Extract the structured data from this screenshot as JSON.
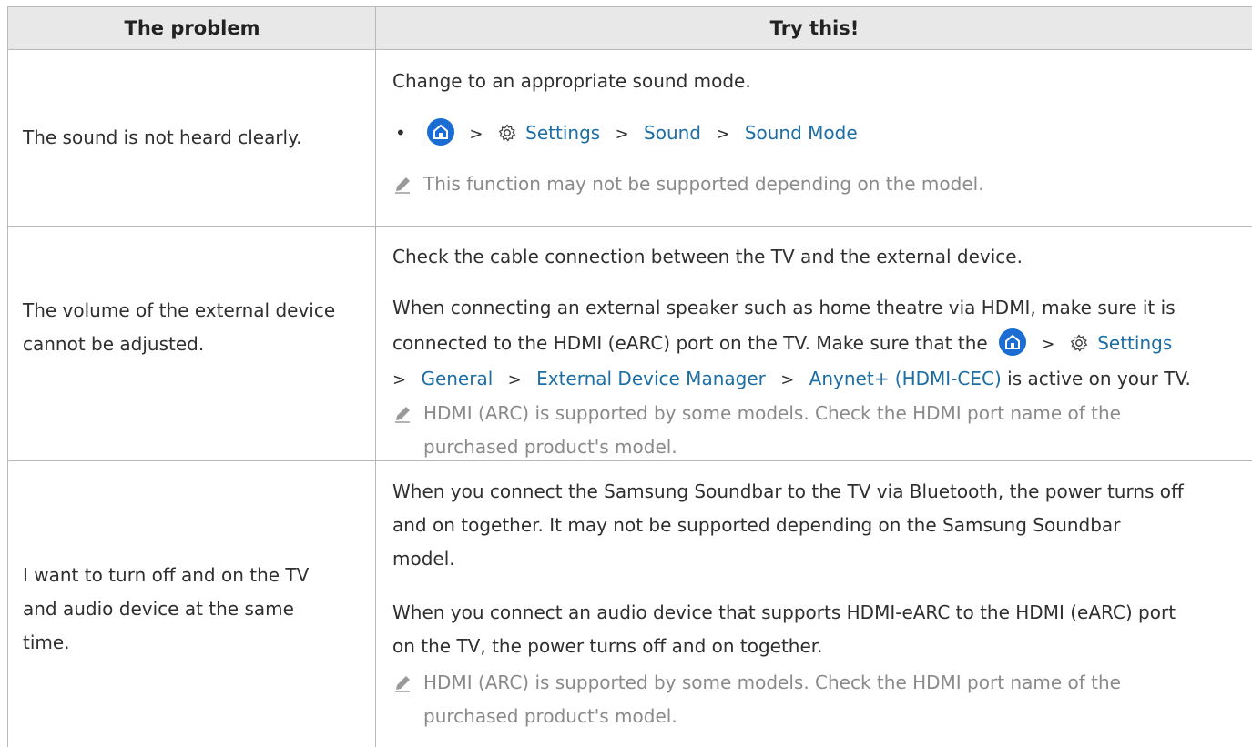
{
  "header": {
    "col1": "The problem",
    "col2": "Try this!"
  },
  "row1": {
    "problem": "The sound is not heard clearly.",
    "intro": "Change to an appropriate sound mode.",
    "path": [
      "Settings",
      "Sound",
      "Sound Mode"
    ],
    "note": "This function may not be supported depending on the model."
  },
  "row2": {
    "problem_l1": "The volume of the external device",
    "problem_l2": "cannot be adjusted.",
    "p1": "Check the cable connection between the TV and the external device.",
    "p2_l1": "When connecting an external speaker such as home theatre via HDMI, make sure it is",
    "p2_l2": "connected to the HDMI (eARC) port on the TV. Make sure that the",
    "p2_settings": "Settings",
    "p2_path": [
      "General",
      "External Device Manager",
      "Anynet+ (HDMI-CEC)"
    ],
    "p2_tail": "is active on your TV.",
    "note_l1": "HDMI (ARC) is supported by some models. Check the HDMI port name of the",
    "note_l2": "purchased product's model."
  },
  "row3": {
    "problem_l1": "I want to turn off and on the TV",
    "problem_l2": "and audio device at the same",
    "problem_l3": "time.",
    "p1_l1": "When you connect the Samsung Soundbar to the TV via Bluetooth, the power turns off",
    "p1_l2": "and on together. It may not be supported depending on the Samsung Soundbar",
    "p1_l3": "model.",
    "p2_l1": "When you connect an audio device that supports HDMI-eARC to the HDMI (eARC) port",
    "p2_l2": "on the TV, the power turns off and on together.",
    "note_l1": "HDMI (ARC) is supported by some models. Check the HDMI port name of the",
    "note_l2": "purchased product's model."
  },
  "colors": {
    "link": "#1c6ea4",
    "note": "#8a8a8a",
    "header_bg": "#e8e8e8",
    "home_icon": "#1b6dd4"
  }
}
